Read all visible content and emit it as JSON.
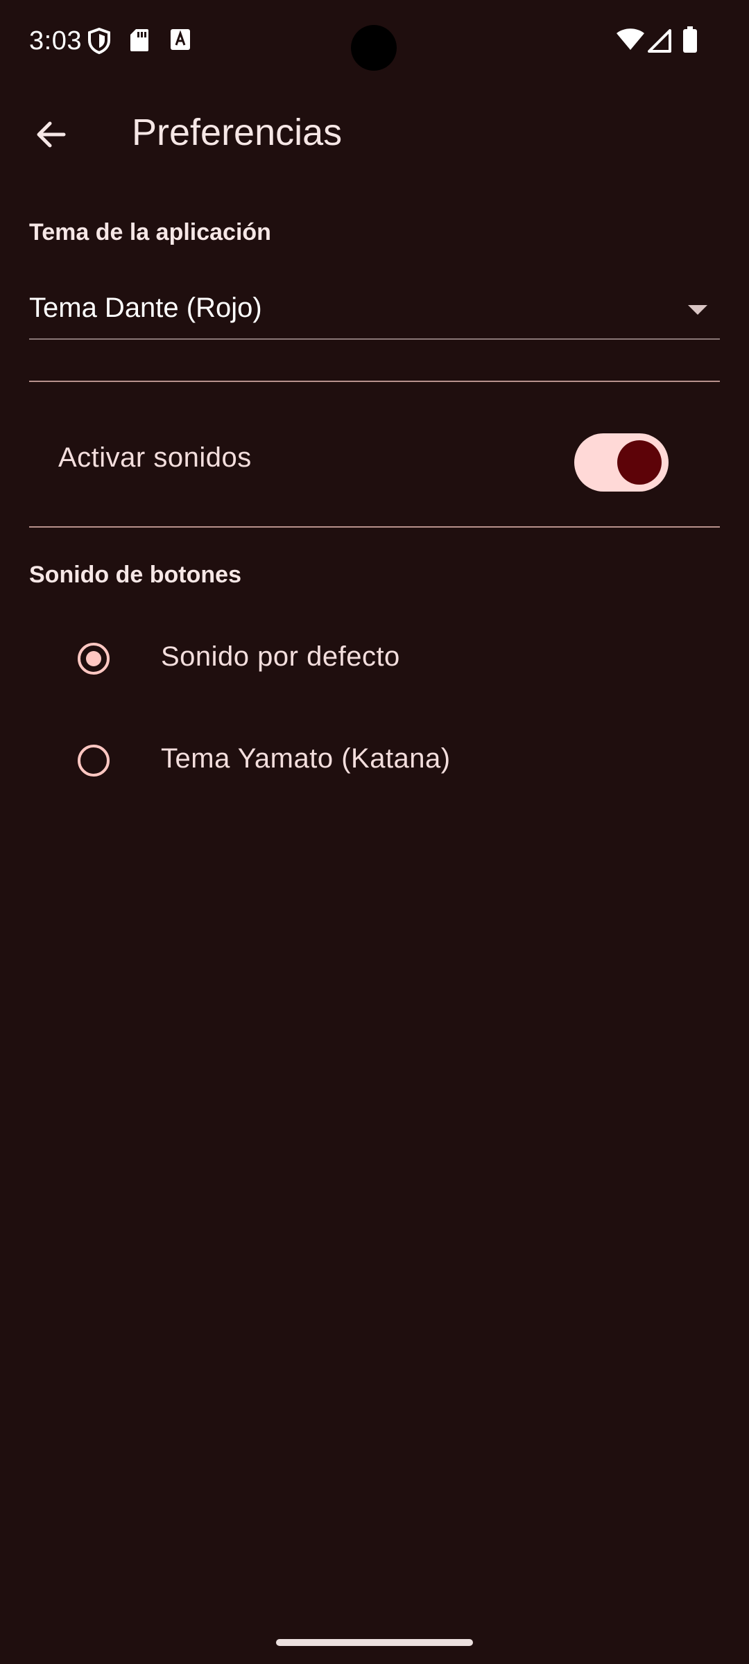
{
  "status_bar": {
    "time": "3:03",
    "icons": [
      "shield-icon",
      "sd-card-icon",
      "keyboard-a-icon",
      "wifi-icon",
      "cell-signal-icon",
      "battery-icon"
    ]
  },
  "app_bar": {
    "back_icon": "arrow-left-icon",
    "title": "Preferencias"
  },
  "theme_section": {
    "label": "Tema de la aplicación",
    "selected_value": "Tema Dante (Rojo)"
  },
  "sounds": {
    "label": "Activar sonidos",
    "enabled": true
  },
  "button_sound_section": {
    "label": "Sonido de botones",
    "options": [
      {
        "label": "Sonido por defecto",
        "selected": true
      },
      {
        "label": "Tema Yamato (Katana)",
        "selected": false
      }
    ]
  },
  "colors": {
    "background": "#1f0e0e",
    "accent": "#ffc7c2",
    "switch_track": "#ffd9d7",
    "switch_thumb": "#5d0308"
  }
}
